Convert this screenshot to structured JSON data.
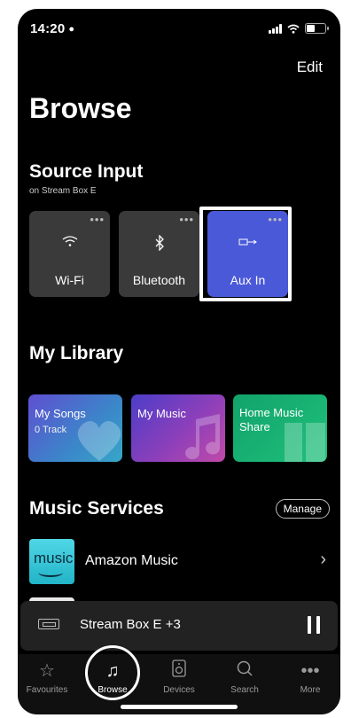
{
  "status": {
    "time": "14:20",
    "person_icon": "person-icon"
  },
  "header": {
    "edit_label": "Edit",
    "title": "Browse"
  },
  "source_input": {
    "title": "Source Input",
    "subtitle": "on Stream Box E",
    "items": [
      {
        "label": "Wi-Fi",
        "icon": "wifi-icon",
        "selected": false
      },
      {
        "label": "Bluetooth",
        "icon": "bluetooth-icon",
        "selected": false
      },
      {
        "label": "Aux In",
        "icon": "aux-in-icon",
        "selected": true
      }
    ]
  },
  "library": {
    "title": "My Library",
    "items": [
      {
        "label": "My Songs",
        "sub": "0 Track"
      },
      {
        "label": "My Music",
        "sub": ""
      },
      {
        "label": "Home Music Share",
        "sub": ""
      }
    ]
  },
  "services": {
    "title": "Music Services",
    "manage_label": "Manage",
    "items": [
      {
        "logo_text": "music",
        "label": "Amazon Music"
      }
    ]
  },
  "now_playing": {
    "label": "Stream Box E +3"
  },
  "tabs": [
    {
      "label": "Favourites",
      "icon": "star-icon"
    },
    {
      "label": "Browse",
      "icon": "music-note-icon",
      "active": true
    },
    {
      "label": "Devices",
      "icon": "speaker-icon"
    },
    {
      "label": "Search",
      "icon": "search-icon"
    },
    {
      "label": "More",
      "icon": "more-icon"
    }
  ],
  "colors": {
    "accent": "#4a59d8",
    "background": "#000000"
  }
}
